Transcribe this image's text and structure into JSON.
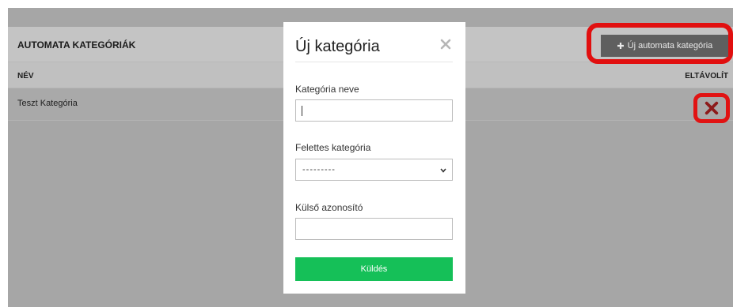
{
  "page": {
    "title": "AUTOMATA KATEGÓRIÁK",
    "new_button_label": "Új automata kategória",
    "columns": {
      "name": "NÉV",
      "remove": "ELTÁVOLÍT"
    },
    "rows": [
      {
        "name": "Teszt Kategória"
      }
    ]
  },
  "modal": {
    "title": "Új kategória",
    "fields": {
      "name_label": "Kategória neve",
      "name_value": "",
      "parent_label": "Felettes kategória",
      "parent_selected": "---------",
      "external_id_label": "Külső azonosító",
      "external_id_value": ""
    },
    "submit_label": "Küldés"
  },
  "icons": {
    "plus": "plus-icon",
    "remove": "remove-icon",
    "close": "close-icon",
    "chevron": "chevron-down-icon"
  },
  "colors": {
    "highlight": "#e11313",
    "submit": "#15c058",
    "new_button": "#5f5f5f",
    "remove_icon": "#8d1a1a"
  }
}
